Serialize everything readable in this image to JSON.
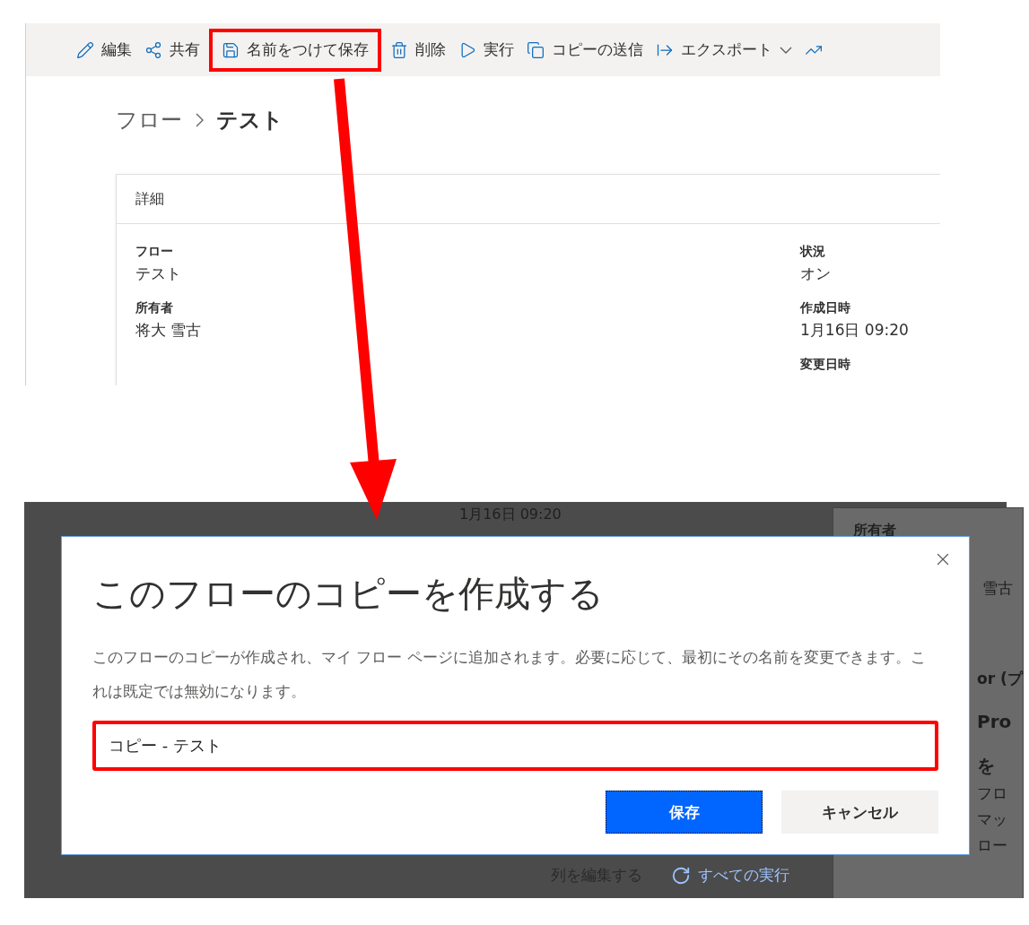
{
  "top_screenshot": {
    "toolbar": [
      {
        "kind": "edit",
        "label": "編集",
        "highlighted": false
      },
      {
        "kind": "share",
        "label": "共有",
        "highlighted": false
      },
      {
        "kind": "save_as",
        "label": "名前をつけて保存",
        "highlighted": true
      },
      {
        "kind": "delete",
        "label": "削除",
        "highlighted": false
      },
      {
        "kind": "run",
        "label": "実行",
        "highlighted": false
      },
      {
        "kind": "send_copy",
        "label": "コピーの送信",
        "highlighted": false
      },
      {
        "kind": "export",
        "label": "エクスポート",
        "highlighted": false
      },
      {
        "kind": "analytics",
        "highlighted": false
      }
    ],
    "breadcrumb": [
      "フロー",
      "テスト"
    ],
    "details": {
      "title": "詳細",
      "left_fields": [
        {
          "label": "フロー",
          "value": "テスト"
        },
        {
          "label": "所有者",
          "value": "将大 雪古"
        }
      ],
      "right_fields": [
        {
          "label": "状況",
          "value": "オン"
        },
        {
          "label": "作成日時",
          "value": "1月16日 09:20"
        },
        {
          "label": "変更日時"
        }
      ]
    }
  },
  "bottom_screenshot": {
    "background": {
      "date": "1月16日 09:20",
      "side_heading": "所有者",
      "side_fragments": [
        {
          "kind": "value",
          "text": "雪古"
        },
        {
          "kind": "label",
          "text": "or (プ"
        },
        {
          "kind": "heading",
          "text": "Pro"
        },
        {
          "kind": "heading",
          "text": "を"
        },
        {
          "kind": "body",
          "text": "フロ"
        },
        {
          "kind": "body",
          "text": "マッ"
        },
        {
          "kind": "body",
          "text": "ロー"
        }
      ],
      "footer_links": [
        {
          "kind": "plain",
          "label": "列を編集する"
        },
        {
          "kind": "refresh",
          "label": "すべての実行"
        }
      ]
    },
    "dialog": {
      "title": "このフローのコピーを作成する",
      "message": "このフローのコピーが作成され、マイ フロー ページに追加されます。必要に応じて、最初にその名前を変更できます。これは既定では無効になります。",
      "name_field": {
        "value": "コピー - テスト",
        "highlighted": true
      },
      "buttons": [
        {
          "kind": "primary",
          "label": "保存"
        },
        {
          "kind": "secondary",
          "label": "キャンセル"
        }
      ]
    }
  }
}
